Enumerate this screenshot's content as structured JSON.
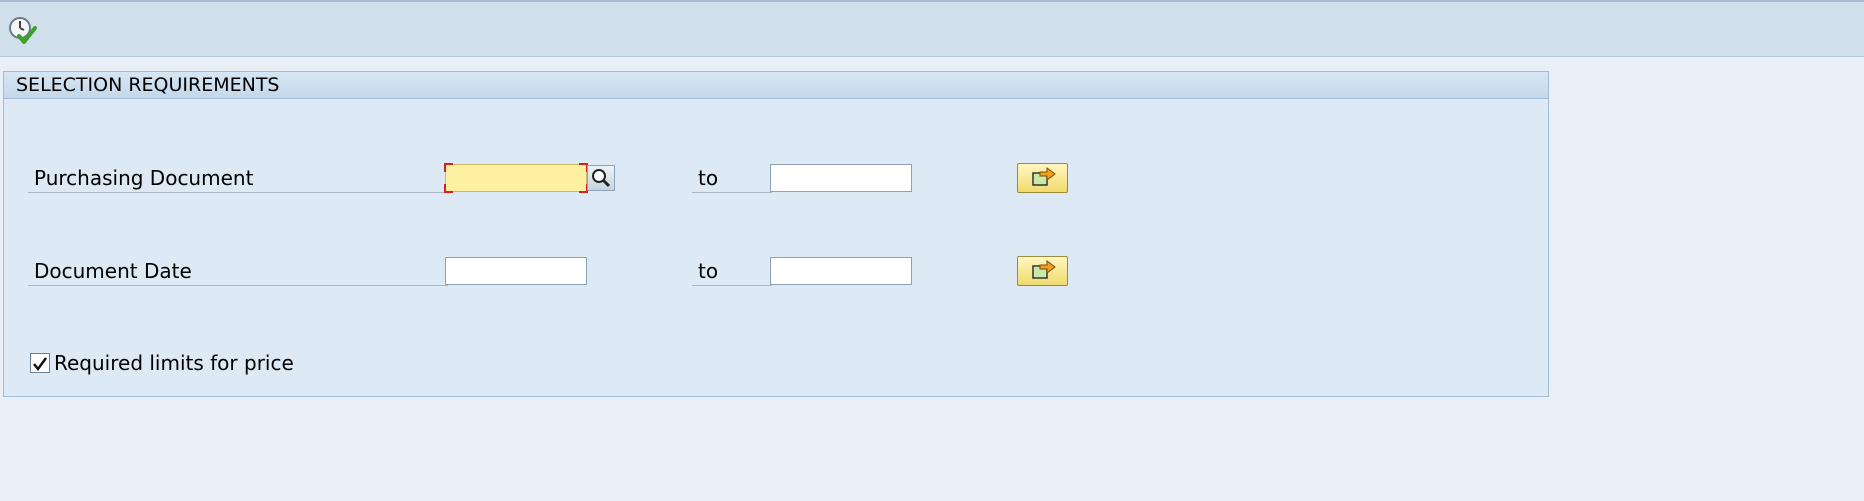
{
  "toolbar": {
    "execute_icon": "execute-clock-check-icon"
  },
  "group": {
    "title": "SELECTION REQUIREMENTS",
    "rows": [
      {
        "label": "Purchasing Document",
        "from_value": "",
        "to_label": "to",
        "to_value": "",
        "multisel_icon": "multiple-selection-arrow-icon"
      },
      {
        "label": "Document Date",
        "from_value": "",
        "to_label": "to",
        "to_value": "",
        "multisel_icon": "multiple-selection-arrow-icon"
      }
    ],
    "checkbox": {
      "label": "Required limits for price",
      "checked": true
    }
  },
  "colors": {
    "required_field": "#fdf0a0",
    "required_corner": "#d62020",
    "button_yellow": "#f1db6c",
    "group_background": "#dde9f4"
  }
}
